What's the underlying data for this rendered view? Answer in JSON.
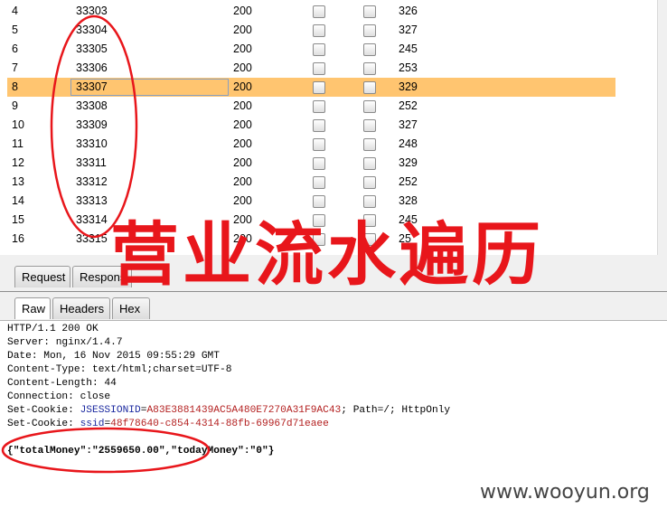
{
  "results_table": {
    "rows": [
      {
        "num": "4",
        "payload": "33303",
        "status": "200",
        "length": "326"
      },
      {
        "num": "5",
        "payload": "33304",
        "status": "200",
        "length": "327"
      },
      {
        "num": "6",
        "payload": "33305",
        "status": "200",
        "length": "245"
      },
      {
        "num": "7",
        "payload": "33306",
        "status": "200",
        "length": "253"
      },
      {
        "num": "8",
        "payload": "33307",
        "status": "200",
        "length": "329"
      },
      {
        "num": "9",
        "payload": "33308",
        "status": "200",
        "length": "252"
      },
      {
        "num": "10",
        "payload": "33309",
        "status": "200",
        "length": "327"
      },
      {
        "num": "11",
        "payload": "33310",
        "status": "200",
        "length": "248"
      },
      {
        "num": "12",
        "payload": "33311",
        "status": "200",
        "length": "329"
      },
      {
        "num": "13",
        "payload": "33312",
        "status": "200",
        "length": "252"
      },
      {
        "num": "14",
        "payload": "33313",
        "status": "200",
        "length": "328"
      },
      {
        "num": "15",
        "payload": "33314",
        "status": "200",
        "length": "245"
      },
      {
        "num": "16",
        "payload": "33315",
        "status": "200",
        "length": "25"
      }
    ],
    "selected_row_num": "8",
    "selection_color": "#ffc570"
  },
  "tabs": {
    "request": "Request",
    "response": "Respons",
    "raw": "Raw",
    "headers": "Headers",
    "hex": "Hex"
  },
  "response": {
    "status_line": "HTTP/1.1 200 OK",
    "server": "Server: nginx/1.4.7",
    "date": "Date: Mon, 16 Nov 2015 09:55:29 GMT",
    "content_type": "Content-Type: text/html;charset=UTF-8",
    "content_length": "Content-Length: 44",
    "connection": "Connection: close",
    "cookie1_prefix": "Set-Cookie: ",
    "cookie1_name": "JSESSIONID",
    "cookie1_eq": "=",
    "cookie1_value": "A83E3881439AC5A480E7270A31F9AC43",
    "cookie1_suffix": "; Path=/; HttpOnly",
    "cookie2_prefix": "Set-Cookie: ",
    "cookie2_name": "ssid",
    "cookie2_eq": "=",
    "cookie2_value": "48f78640-c854-4314-88fb-69967d71eaee",
    "body": "{\"totalMoney\":\"2559650.00\",\"todayMoney\":\"0\"}"
  },
  "overlay_title": "营业流水遍历",
  "watermark": "www.wooyun.org",
  "colors": {
    "annotation_red": "#e8161b",
    "header_value_blue": "#1c2aa0",
    "header_value_red": "#b31f1f"
  }
}
